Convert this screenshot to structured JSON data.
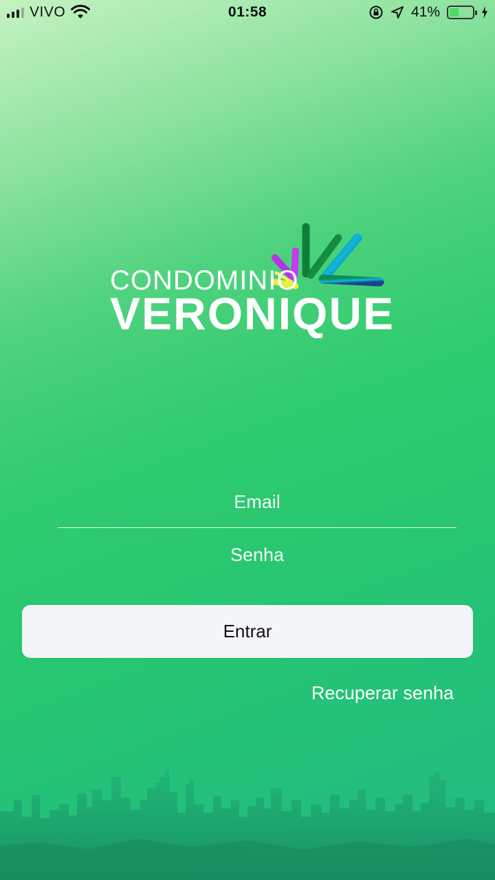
{
  "status_bar": {
    "carrier": "VIVO",
    "time": "01:58",
    "battery_percent": "41%",
    "battery_level": 0.41,
    "icons": [
      "signal-icon",
      "wifi-icon",
      "rotation-lock-icon",
      "location-arrow-icon",
      "battery-icon",
      "charging-bolt-icon"
    ]
  },
  "logo": {
    "line1": "CONDOMINIO",
    "line2": "VERONIQUE"
  },
  "form": {
    "email_placeholder": "Email",
    "password_placeholder": "Senha",
    "submit_label": "Entrar",
    "recover_label": "Recuperar senha"
  },
  "colors": {
    "background_top": "#c6f2c2",
    "background_mid": "#2fcb6f",
    "background_bottom": "#22b985",
    "button_bg": "#f3f5f8",
    "button_text": "#111111"
  }
}
